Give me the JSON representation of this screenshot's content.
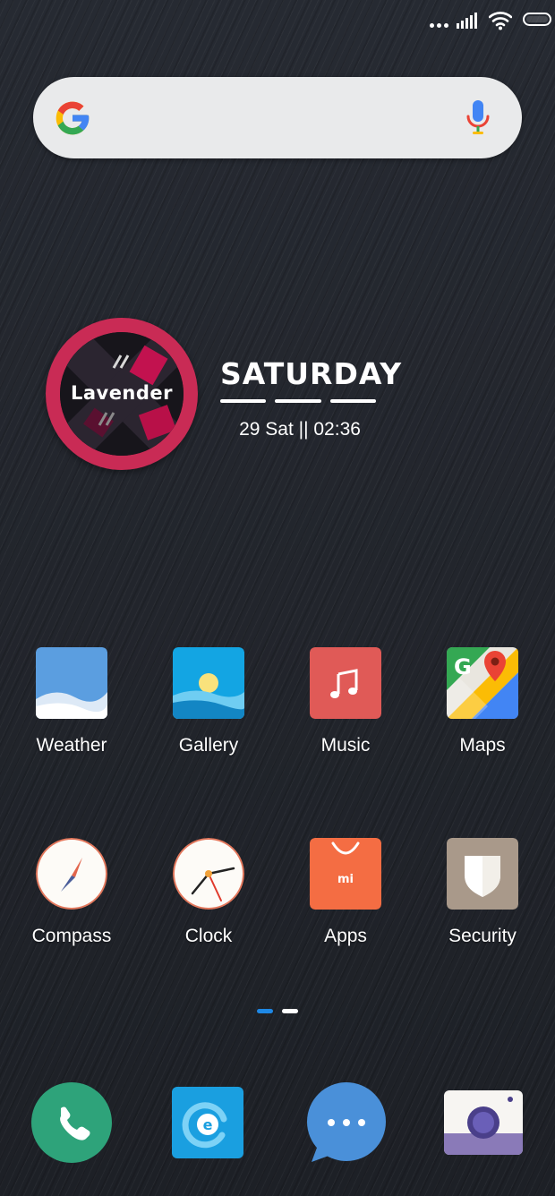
{
  "status_bar": {
    "icons": [
      "signal-dots-icon",
      "cellular-signal-icon",
      "wifi-icon",
      "battery-icon"
    ]
  },
  "search_widget": {
    "icons": [
      "google-logo-icon",
      "microphone-icon"
    ],
    "colors": {
      "blue": "#4285F4",
      "red": "#EA4335",
      "yellow": "#FBBC05",
      "green": "#34A853"
    }
  },
  "clock_widget": {
    "badge_label": "Lavender",
    "day": "SATURDAY",
    "date_time": "29 Sat || 02:36",
    "ring_color": "#c92b55"
  },
  "apps": [
    {
      "label": "Weather",
      "icon": "weather-icon"
    },
    {
      "label": "Gallery",
      "icon": "gallery-icon"
    },
    {
      "label": "Music",
      "icon": "music-icon"
    },
    {
      "label": "Maps",
      "icon": "maps-icon"
    },
    {
      "label": "Compass",
      "icon": "compass-icon"
    },
    {
      "label": "Clock",
      "icon": "clock-icon"
    },
    {
      "label": "Apps",
      "icon": "mi-store-icon"
    },
    {
      "label": "Security",
      "icon": "security-shield-icon"
    }
  ],
  "page_indicator": {
    "pages": 2,
    "active_page": 1,
    "active_color": "#1e88e5"
  },
  "dock": [
    {
      "icon": "phone-icon"
    },
    {
      "icon": "browser-icon"
    },
    {
      "icon": "messages-icon"
    },
    {
      "icon": "camera-icon"
    }
  ]
}
